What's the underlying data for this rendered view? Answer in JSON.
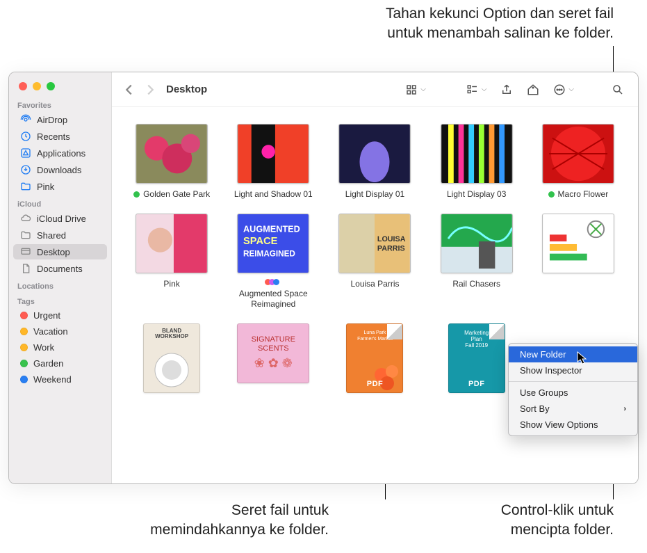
{
  "callouts": {
    "top": "Tahan kekunci Option dan seret fail\nuntuk menambah salinan ke folder.",
    "bottom_left": "Seret fail untuk\nmemindahkannya ke folder.",
    "bottom_right": "Control-klik untuk\nmencipta folder."
  },
  "window": {
    "title": "Desktop"
  },
  "sidebar": {
    "sections": [
      {
        "label": "Favorites",
        "items": [
          {
            "icon": "airdrop",
            "name": "AirDrop"
          },
          {
            "icon": "recents",
            "name": "Recents"
          },
          {
            "icon": "apps",
            "name": "Applications"
          },
          {
            "icon": "downloads",
            "name": "Downloads"
          },
          {
            "icon": "folder",
            "name": "Pink"
          }
        ]
      },
      {
        "label": "iCloud",
        "items": [
          {
            "icon": "cloud",
            "name": "iCloud Drive"
          },
          {
            "icon": "shared",
            "name": "Shared"
          },
          {
            "icon": "desktop",
            "name": "Desktop",
            "selected": true
          },
          {
            "icon": "doc",
            "name": "Documents"
          }
        ]
      },
      {
        "label": "Locations",
        "items": []
      },
      {
        "label": "Tags",
        "items": [
          {
            "tag": "#ff5b51",
            "name": "Urgent"
          },
          {
            "tag": "#ffb728",
            "name": "Vacation"
          },
          {
            "tag": "#ffb728",
            "name": "Work"
          },
          {
            "tag": "#39c24d",
            "name": "Garden"
          },
          {
            "tag": "#2a7ff2",
            "name": "Weekend"
          }
        ]
      }
    ]
  },
  "files": [
    {
      "label": "Golden Gate Park",
      "tag": "#32c24d"
    },
    {
      "label": "Light and Shadow 01"
    },
    {
      "label": "Light Display 01"
    },
    {
      "label": "Light Display 03"
    },
    {
      "label": "Macro Flower",
      "tag": "#32c24d"
    },
    {
      "label": "Pink"
    },
    {
      "label": "Augmented Space Reimagined",
      "multitag": true
    },
    {
      "label": "Louisa Parris"
    },
    {
      "label": "Rail Chasers"
    },
    {
      "label": ""
    },
    {
      "label": "",
      "doc": true
    },
    {
      "label": "",
      "doc": true
    },
    {
      "label": "",
      "pdf": true
    },
    {
      "label": "",
      "pdf": true
    }
  ],
  "context_menu": {
    "items": [
      {
        "label": "New Folder",
        "highlight": true
      },
      {
        "label": "Show Inspector"
      },
      {
        "sep": true
      },
      {
        "label": "Use Groups"
      },
      {
        "label": "Sort By",
        "submenu": true
      },
      {
        "label": "Show View Options"
      }
    ]
  },
  "thumbs": {
    "row3": {
      "bland": {
        "t1": "BLAND",
        "t2": "WORKSHOP"
      },
      "scents": {
        "t1": "SIGNATURE",
        "t2": "SCENTS"
      },
      "luna": {
        "t1": "Luna Park",
        "t2": "Farmer's Market"
      },
      "plan": {
        "t1": "Marketing",
        "t2": "Plan",
        "t3": "Fall 2019"
      }
    },
    "row2": {
      "aug": {
        "l1": "AUGMENTED",
        "l2": "SPACE",
        "l3": "REIMAGINED"
      },
      "louisa": {
        "l1": "LOUISA",
        "l2": "PARRIS"
      }
    }
  }
}
